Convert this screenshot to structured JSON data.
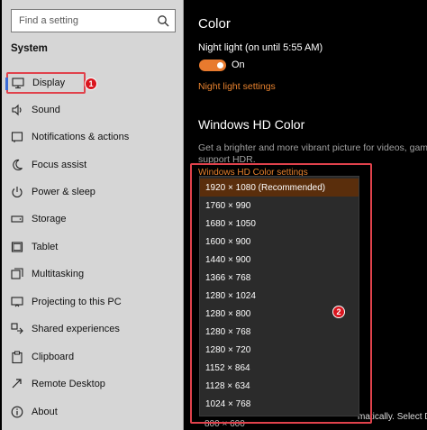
{
  "sidebar": {
    "search_placeholder": "Find a setting",
    "section_title": "System",
    "items": [
      {
        "label": "Display",
        "icon": "monitor-icon"
      },
      {
        "label": "Sound",
        "icon": "speaker-icon"
      },
      {
        "label": "Notifications & actions",
        "icon": "notification-icon"
      },
      {
        "label": "Focus assist",
        "icon": "moon-icon"
      },
      {
        "label": "Power & sleep",
        "icon": "power-icon"
      },
      {
        "label": "Storage",
        "icon": "storage-icon"
      },
      {
        "label": "Tablet",
        "icon": "tablet-icon"
      },
      {
        "label": "Multitasking",
        "icon": "multitasking-icon"
      },
      {
        "label": "Projecting to this PC",
        "icon": "projector-icon"
      },
      {
        "label": "Shared experiences",
        "icon": "share-icon"
      },
      {
        "label": "Clipboard",
        "icon": "clipboard-icon"
      },
      {
        "label": "Remote Desktop",
        "icon": "remote-desktop-icon"
      },
      {
        "label": "About",
        "icon": "info-icon"
      }
    ],
    "selected_index": 0
  },
  "main": {
    "color_heading": "Color",
    "night_light_label": "Night light (on until 5:55 AM)",
    "toggle_state": "On",
    "night_light_link": "Night light settings",
    "hd_heading": "Windows HD Color",
    "hd_description_line1": "Get a brighter and more vibrant picture for videos, games and a",
    "hd_description_line2": "support HDR.",
    "hd_link": "Windows HD Color settings",
    "obscured_right_text": "matically. Select D",
    "obscured_below_text": "800 × 600"
  },
  "resolution_menu": {
    "options": [
      "1920 × 1080 (Recommended)",
      "1760 × 990",
      "1680 × 1050",
      "1600 × 900",
      "1440 × 900",
      "1366 × 768",
      "1280 × 1024",
      "1280 × 800",
      "1280 × 768",
      "1280 × 720",
      "1152 × 864",
      "1128 × 634",
      "1024 × 768"
    ],
    "selected_index": 0
  },
  "badges": {
    "step1": "1",
    "step2": "2"
  },
  "colors": {
    "accent": "#e8822e",
    "highlight_border": "#e0424c",
    "badge": "#d9151e",
    "selected_option": "#5a2e0c"
  }
}
